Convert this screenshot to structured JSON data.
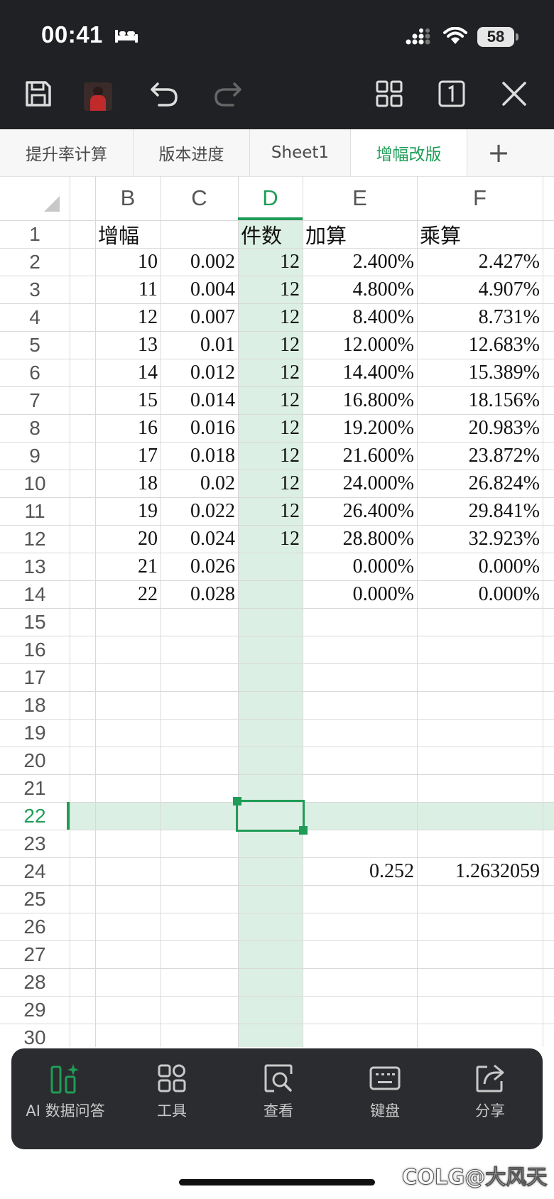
{
  "status_bar": {
    "time": "00:41",
    "battery": "58"
  },
  "sheet_tabs": [
    {
      "label": "提升率计算",
      "active": false
    },
    {
      "label": "版本进度",
      "active": false
    },
    {
      "label": "Sheet1",
      "active": false
    },
    {
      "label": "增幅改版",
      "active": true
    }
  ],
  "add_tab_label": "+",
  "columns": [
    "B",
    "C",
    "D",
    "E",
    "F"
  ],
  "active_column": "D",
  "rows": [
    "1",
    "2",
    "3",
    "4",
    "5",
    "6",
    "7",
    "8",
    "9",
    "10",
    "11",
    "12",
    "13",
    "14",
    "15",
    "16",
    "17",
    "18",
    "19",
    "20",
    "21",
    "22",
    "23",
    "24",
    "25",
    "26",
    "27",
    "28",
    "29",
    "30"
  ],
  "active_row": "22",
  "cells": {
    "header": {
      "B": "增幅",
      "D": "件数",
      "E": "加算",
      "F": "乘算"
    },
    "data": [
      {
        "B": "10",
        "C": "0.002",
        "D": "12",
        "E": "2.400%",
        "F": "2.427%"
      },
      {
        "B": "11",
        "C": "0.004",
        "D": "12",
        "E": "4.800%",
        "F": "4.907%"
      },
      {
        "B": "12",
        "C": "0.007",
        "D": "12",
        "E": "8.400%",
        "F": "8.731%"
      },
      {
        "B": "13",
        "C": "0.01",
        "D": "12",
        "E": "12.000%",
        "F": "12.683%"
      },
      {
        "B": "14",
        "C": "0.012",
        "D": "12",
        "E": "14.400%",
        "F": "15.389%"
      },
      {
        "B": "15",
        "C": "0.014",
        "D": "12",
        "E": "16.800%",
        "F": "18.156%"
      },
      {
        "B": "16",
        "C": "0.016",
        "D": "12",
        "E": "19.200%",
        "F": "20.983%"
      },
      {
        "B": "17",
        "C": "0.018",
        "D": "12",
        "E": "21.600%",
        "F": "23.872%"
      },
      {
        "B": "18",
        "C": "0.02",
        "D": "12",
        "E": "24.000%",
        "F": "26.824%"
      },
      {
        "B": "19",
        "C": "0.022",
        "D": "12",
        "E": "26.400%",
        "F": "29.841%"
      },
      {
        "B": "20",
        "C": "0.024",
        "D": "12",
        "E": "28.800%",
        "F": "32.923%"
      },
      {
        "B": "21",
        "C": "0.026",
        "D": "",
        "E": "0.000%",
        "F": "0.000%"
      },
      {
        "B": "22",
        "C": "0.028",
        "D": "",
        "E": "0.000%",
        "F": "0.000%"
      }
    ],
    "row24": {
      "E": "0.252",
      "F": "1.2632059"
    }
  },
  "bottom_toolbar": [
    {
      "label": "AI 数据问答",
      "icon": "ai-data-icon"
    },
    {
      "label": "工具",
      "icon": "tools-grid-icon"
    },
    {
      "label": "查看",
      "icon": "view-search-icon"
    },
    {
      "label": "键盘",
      "icon": "keyboard-icon"
    },
    {
      "label": "分享",
      "icon": "share-icon"
    }
  ],
  "watermark": "COLG@大风天",
  "colors": {
    "accent": "#1f9d57",
    "highlight": "#dcefe4",
    "dark": "#202124"
  }
}
